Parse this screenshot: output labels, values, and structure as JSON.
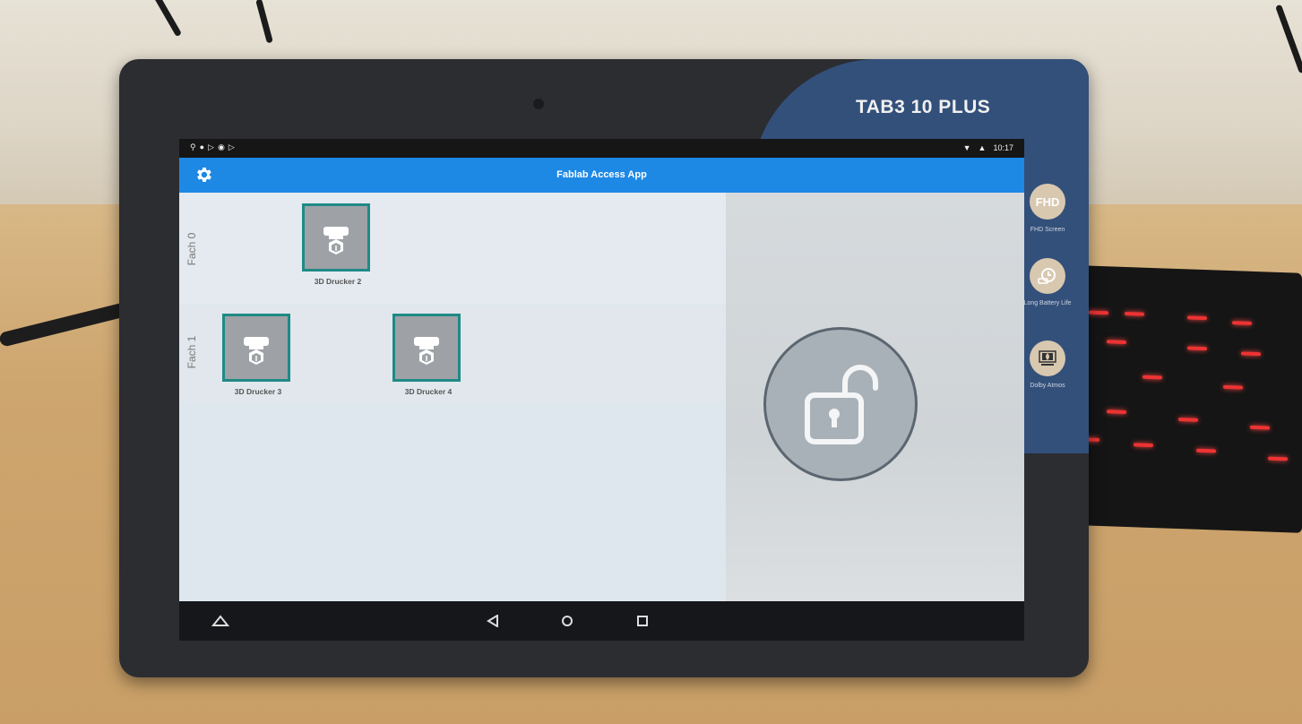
{
  "tablet": {
    "brand": "TAB3 10 PLUS",
    "features": [
      {
        "badge": "FHD",
        "label": "FHD Screen"
      },
      {
        "badge": "",
        "label": "Long Battery Life"
      },
      {
        "badge": "",
        "label": "Dolby Atmos"
      }
    ]
  },
  "status_bar": {
    "time": "10:17",
    "left_icons": [
      "usb-icon",
      "notification-icon",
      "play-icon",
      "android-icon",
      "play-icon"
    ],
    "right_icons": [
      "wifi-icon",
      "account-icon"
    ]
  },
  "app_bar": {
    "title": "Fablab Access App",
    "settings_icon": "gear-icon"
  },
  "sections": [
    {
      "label": "Fach 0",
      "machines": [
        {
          "name": "3D Drucker 2",
          "icon": "3d-printer-icon"
        }
      ]
    },
    {
      "label": "Fach 1",
      "machines": [
        {
          "name": "3D Drucker 3",
          "icon": "3d-printer-icon"
        },
        {
          "name": "3D Drucker 4",
          "icon": "3d-printer-icon"
        }
      ]
    }
  ],
  "side_panel": {
    "lock_icon": "unlock-icon"
  },
  "nav_bar": {
    "buttons": [
      "home-triangle-icon",
      "back-icon",
      "home-icon",
      "recents-icon"
    ]
  },
  "colors": {
    "app_bar": "#1e88e5",
    "tile_border": "#1f8a86",
    "tile_fill": "#9ea2a6"
  }
}
